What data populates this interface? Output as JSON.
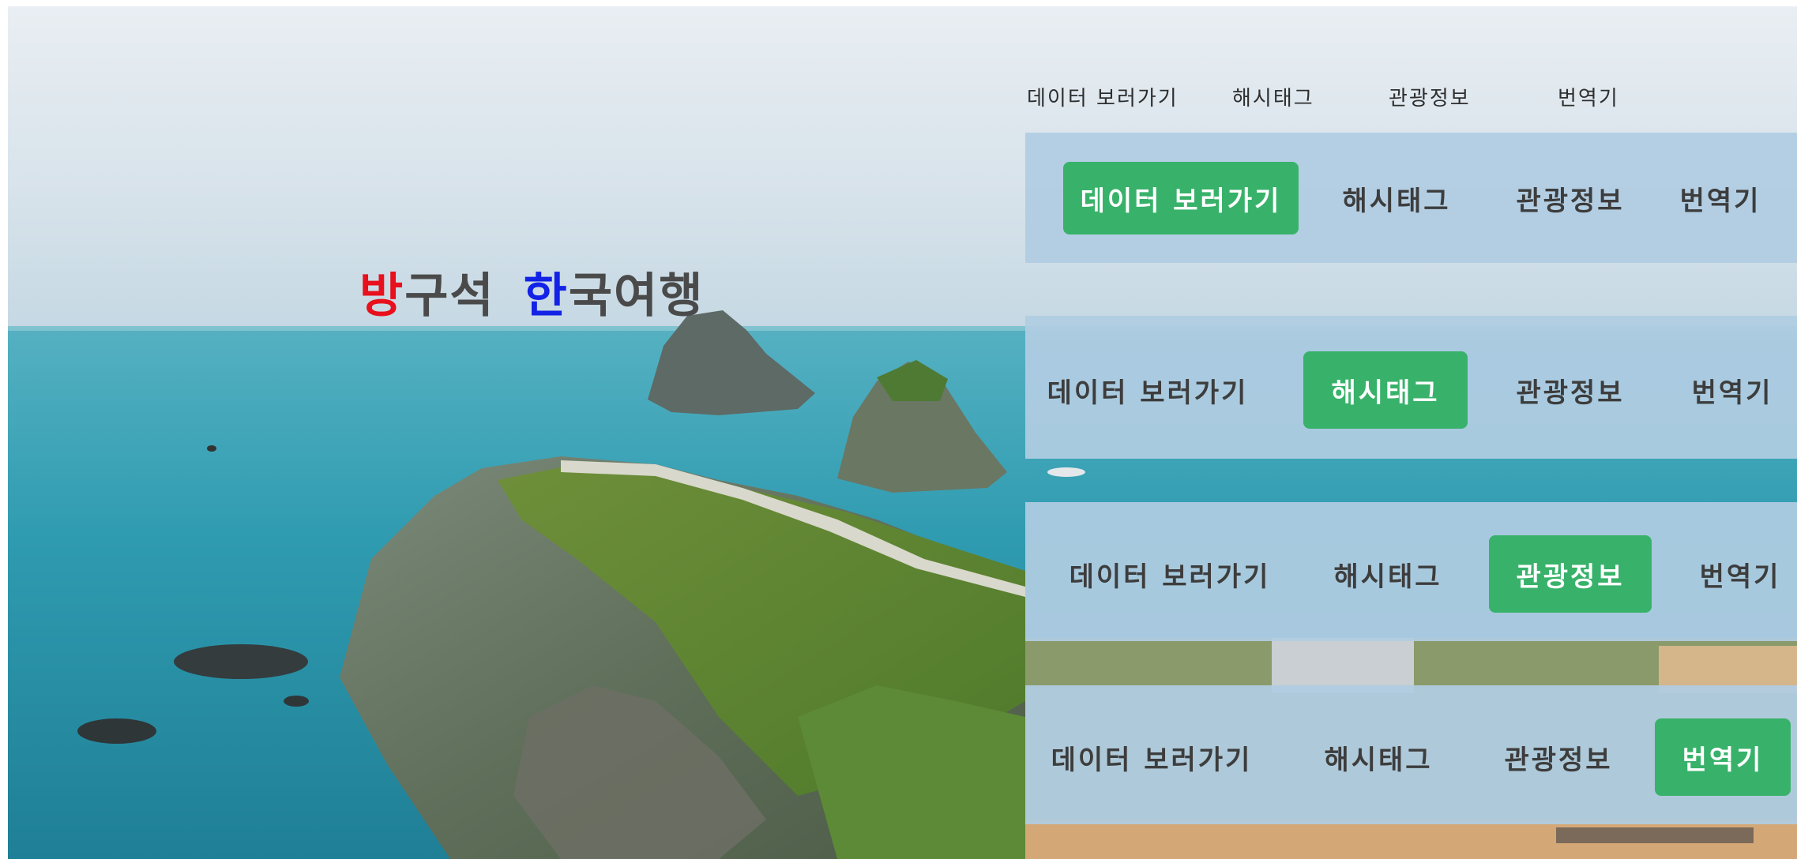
{
  "logo": {
    "char1": "방",
    "part1": "구석",
    "char2": "한",
    "part2": "국여행"
  },
  "top_nav": {
    "items": [
      "데이터 보러가기",
      "해시태그",
      "관광정보",
      "번역기"
    ]
  },
  "nav_bars": [
    {
      "items": [
        "데이터 보러가기",
        "해시태그",
        "관광정보",
        "번역기"
      ],
      "active": 0
    },
    {
      "items": [
        "데이터 보러가기",
        "해시태그",
        "관광정보",
        "번역기"
      ],
      "active": 1
    },
    {
      "items": [
        "데이터 보러가기",
        "해시태그",
        "관광정보",
        "번역기"
      ],
      "active": 2
    },
    {
      "items": [
        "데이터 보러가기",
        "해시태그",
        "관광정보",
        "번역기"
      ],
      "active": 3
    }
  ],
  "colors": {
    "active_button": "#38b26a",
    "logo_accent_red": "#e8101c",
    "logo_accent_blue": "#1222e6",
    "nav_bar_bg": "#b0cce2"
  }
}
